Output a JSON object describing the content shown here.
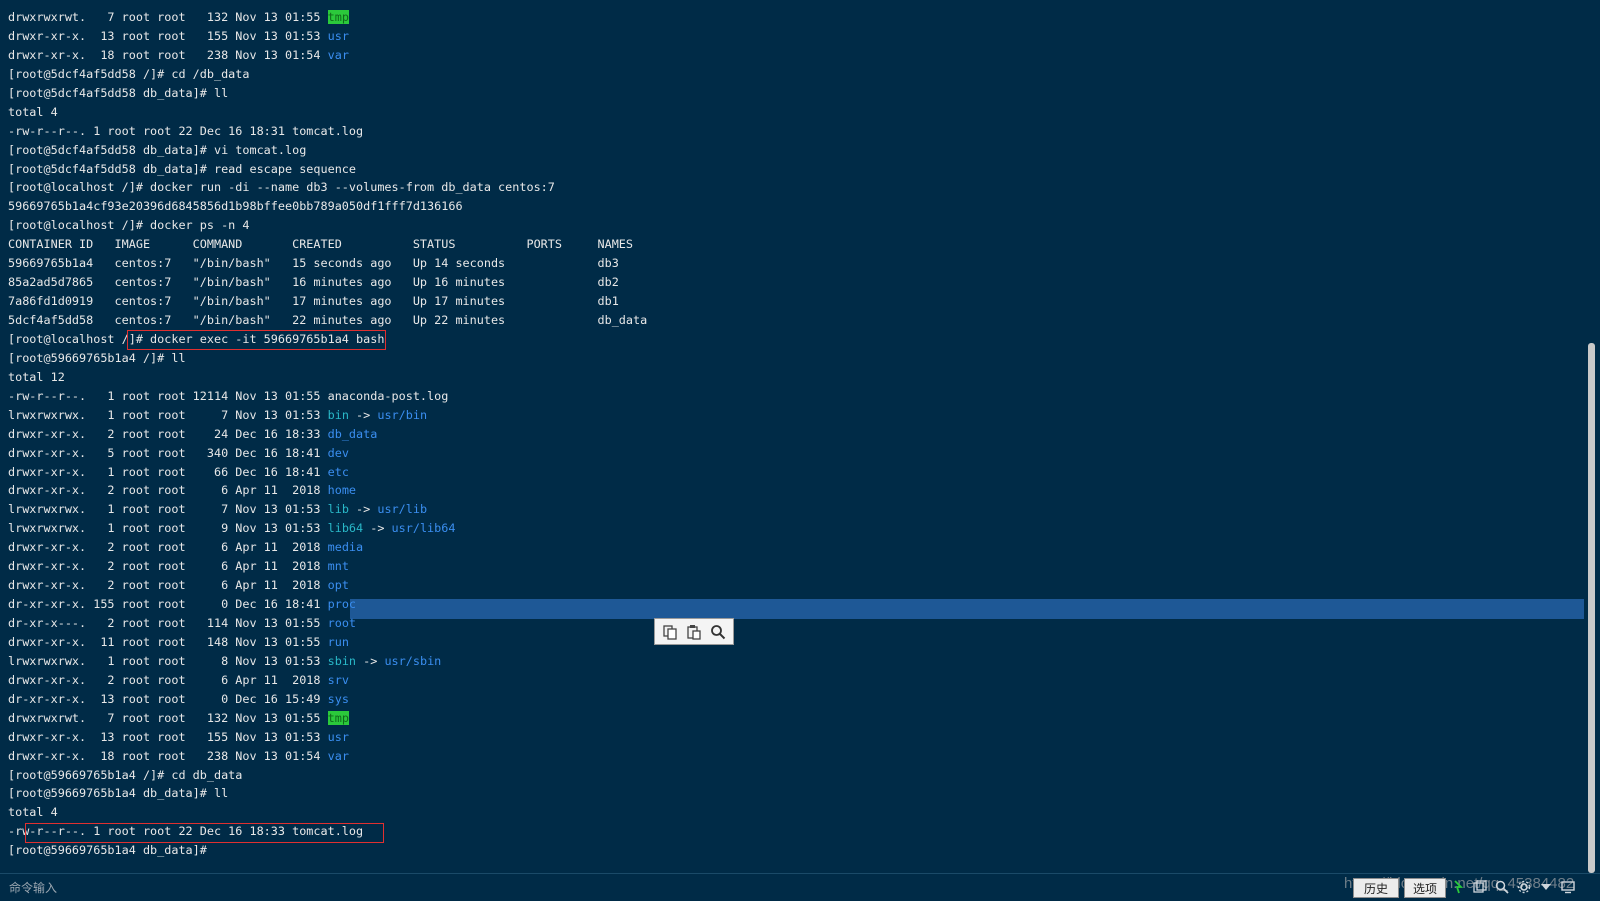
{
  "terminal": {
    "colors": {
      "background": "#002b47",
      "foreground": "#e8e8e8",
      "directory": "#3a8ef0",
      "symlink": "#29b8c8",
      "highlight_bg": "#2bc93b",
      "highlight_fg": "#0f6a1a",
      "selection": "#1e5896",
      "annotation": "#e03030"
    },
    "lines": [
      [
        {
          "t": "drwxrwxrwt.   7 root root   132 Nov 13 01:55 "
        },
        {
          "t": "tmp",
          "c": "hl"
        }
      ],
      [
        {
          "t": "drwxr-xr-x.  13 root root   155 Nov 13 01:53 "
        },
        {
          "t": "usr",
          "c": "dir"
        }
      ],
      [
        {
          "t": "drwxr-xr-x.  18 root root   238 Nov 13 01:54 "
        },
        {
          "t": "var",
          "c": "dir"
        }
      ],
      [
        {
          "t": "[root@5dcf4af5dd58 /]# cd /db_data"
        }
      ],
      [
        {
          "t": "[root@5dcf4af5dd58 db_data]# ll"
        }
      ],
      [
        {
          "t": "total 4"
        }
      ],
      [
        {
          "t": "-rw-r--r--. 1 root root 22 Dec 16 18:31 tomcat.log"
        }
      ],
      [
        {
          "t": "[root@5dcf4af5dd58 db_data]# vi tomcat.log"
        }
      ],
      [
        {
          "t": "[root@5dcf4af5dd58 db_data]# read escape sequence"
        }
      ],
      [
        {
          "t": "[root@localhost /]# docker run -di --name db3 --volumes-from db_data centos:7"
        }
      ],
      [
        {
          "t": "59669765b1a4cf93e20396d6845856d1b98bffee0bb789a050df1fff7d136166"
        }
      ],
      [
        {
          "t": "[root@localhost /]# docker ps -n 4"
        }
      ],
      [
        {
          "t": "CONTAINER ID   IMAGE      COMMAND       CREATED          STATUS          PORTS     NAMES"
        }
      ],
      [
        {
          "t": "59669765b1a4   centos:7   \"/bin/bash\"   15 seconds ago   Up 14 seconds             db3"
        }
      ],
      [
        {
          "t": "85a2ad5d7865   centos:7   \"/bin/bash\"   16 minutes ago   Up 16 minutes             db2"
        }
      ],
      [
        {
          "t": "7a86fd1d0919   centos:7   \"/bin/bash\"   17 minutes ago   Up 17 minutes             db1"
        }
      ],
      [
        {
          "t": "5dcf4af5dd58   centos:7   \"/bin/bash\"   22 minutes ago   Up 22 minutes             db_data"
        }
      ],
      [
        {
          "t": "[root@localhost /]# docker exec -it 59669765b1a4 bash"
        }
      ],
      [
        {
          "t": "[root@59669765b1a4 /]# ll"
        }
      ],
      [
        {
          "t": "total 12"
        }
      ],
      [
        {
          "t": "-rw-r--r--.   1 root root 12114 Nov 13 01:55 anaconda-post.log"
        }
      ],
      [
        {
          "t": "lrwxrwxrwx.   1 root root     7 Nov 13 01:53 "
        },
        {
          "t": "bin",
          "c": "link"
        },
        {
          "t": " -> "
        },
        {
          "t": "usr/bin",
          "c": "dir"
        }
      ],
      [
        {
          "t": "drwxr-xr-x.   2 root root    24 Dec 16 18:33 "
        },
        {
          "t": "db_data",
          "c": "dir"
        }
      ],
      [
        {
          "t": "drwxr-xr-x.   5 root root   340 Dec 16 18:41 "
        },
        {
          "t": "dev",
          "c": "dir"
        }
      ],
      [
        {
          "t": "drwxr-xr-x.   1 root root    66 Dec 16 18:41 "
        },
        {
          "t": "etc",
          "c": "dir"
        }
      ],
      [
        {
          "t": "drwxr-xr-x.   2 root root     6 Apr 11  2018 "
        },
        {
          "t": "home",
          "c": "dir"
        }
      ],
      [
        {
          "t": "lrwxrwxrwx.   1 root root     7 Nov 13 01:53 "
        },
        {
          "t": "lib",
          "c": "link"
        },
        {
          "t": " -> "
        },
        {
          "t": "usr/lib",
          "c": "dir"
        }
      ],
      [
        {
          "t": "lrwxrwxrwx.   1 root root     9 Nov 13 01:53 "
        },
        {
          "t": "lib64",
          "c": "link"
        },
        {
          "t": " -> "
        },
        {
          "t": "usr/lib64",
          "c": "dir"
        }
      ],
      [
        {
          "t": "drwxr-xr-x.   2 root root     6 Apr 11  2018 "
        },
        {
          "t": "media",
          "c": "dir"
        }
      ],
      [
        {
          "t": "drwxr-xr-x.   2 root root     6 Apr 11  2018 "
        },
        {
          "t": "mnt",
          "c": "dir"
        }
      ],
      [
        {
          "t": "drwxr-xr-x.   2 root root     6 Apr 11  2018 "
        },
        {
          "t": "opt",
          "c": "dir"
        }
      ],
      [
        {
          "t": "dr-xr-xr-x. 155 root root     0 Dec 16 18:41 "
        },
        {
          "t": "proc",
          "c": "dir"
        }
      ],
      [
        {
          "t": "dr-xr-x---.   2 root root   114 Nov 13 01:55 "
        },
        {
          "t": "root",
          "c": "dir"
        }
      ],
      [
        {
          "t": "drwxr-xr-x.  11 root root   148 Nov 13 01:55 "
        },
        {
          "t": "run",
          "c": "dir"
        }
      ],
      [
        {
          "t": "lrwxrwxrwx.   1 root root     8 Nov 13 01:53 "
        },
        {
          "t": "sbin",
          "c": "link"
        },
        {
          "t": " -> "
        },
        {
          "t": "usr/sbin",
          "c": "dir"
        }
      ],
      [
        {
          "t": "drwxr-xr-x.   2 root root     6 Apr 11  2018 "
        },
        {
          "t": "srv",
          "c": "dir"
        }
      ],
      [
        {
          "t": "dr-xr-xr-x.  13 root root     0 Dec 16 15:49 "
        },
        {
          "t": "sys",
          "c": "dir"
        }
      ],
      [
        {
          "t": "drwxrwxrwt.   7 root root   132 Nov 13 01:55 "
        },
        {
          "t": "tmp",
          "c": "hl"
        }
      ],
      [
        {
          "t": "drwxr-xr-x.  13 root root   155 Nov 13 01:53 "
        },
        {
          "t": "usr",
          "c": "dir"
        }
      ],
      [
        {
          "t": "drwxr-xr-x.  18 root root   238 Nov 13 01:54 "
        },
        {
          "t": "var",
          "c": "dir"
        }
      ],
      [
        {
          "t": "[root@59669765b1a4 /]# cd db_data"
        }
      ],
      [
        {
          "t": "[root@59669765b1a4 db_data]# ll"
        }
      ],
      [
        {
          "t": "total 4"
        }
      ],
      [
        {
          "t": "-rw-r--r--. 1 root root 22 Dec 16 18:33 tomcat.log"
        }
      ],
      [
        {
          "t": "[root@59669765b1a4 db_data]#"
        }
      ]
    ]
  },
  "context_toolbar": {
    "icons": [
      "copy-icon",
      "paste-icon",
      "search-icon"
    ]
  },
  "bottom_bar": {
    "command_input_label": "命令输入",
    "history_button": "历史",
    "options_button": "选项",
    "watermark": "https://blog.csdn.net/qq_45384482",
    "status_icons": [
      "cursor-icon",
      "window-icon",
      "search-icon",
      "settings-icon",
      "arrow-down-icon",
      "screen-icon"
    ]
  }
}
